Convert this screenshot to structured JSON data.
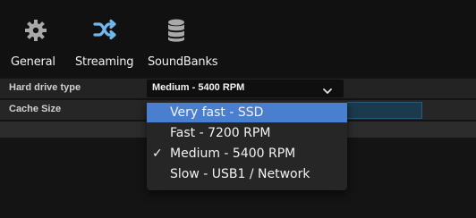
{
  "toolbar": {
    "tabs": [
      {
        "label": "General",
        "icon": "gear-icon"
      },
      {
        "label": "Streaming",
        "icon": "shuffle-icon"
      },
      {
        "label": "SoundBanks",
        "icon": "database-icon"
      }
    ],
    "active_tab": "Streaming",
    "accent_color": "#6fb8ee"
  },
  "properties": {
    "hard_drive_type": {
      "label": "Hard drive type",
      "value": "Medium - 5400 RPM"
    },
    "cache_size": {
      "label": "Cache Size"
    }
  },
  "dropdown": {
    "options": [
      {
        "label": "Very fast - SSD",
        "checked": false,
        "highlighted": true
      },
      {
        "label": "Fast - 7200 RPM",
        "checked": false,
        "highlighted": false
      },
      {
        "label": "Medium - 5400 RPM",
        "checked": true,
        "highlighted": false
      },
      {
        "label": "Slow - USB1 / Network",
        "checked": false,
        "highlighted": false
      }
    ],
    "check_glyph": "✓",
    "highlight_color": "#4a7ecf"
  }
}
